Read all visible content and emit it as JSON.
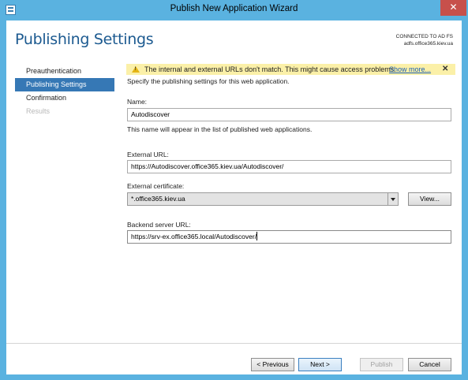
{
  "window": {
    "title": "Publish New Application Wizard",
    "close_glyph": "✕"
  },
  "header": {
    "title": "Publishing Settings",
    "connection_label": "CONNECTED TO AD FS",
    "connection_server": "adfs.office365.kiev.ua"
  },
  "nav": {
    "items": [
      {
        "label": "Preauthentication",
        "state": "normal"
      },
      {
        "label": "Publishing Settings",
        "state": "active"
      },
      {
        "label": "Confirmation",
        "state": "normal"
      },
      {
        "label": "Results",
        "state": "disabled"
      }
    ]
  },
  "warning": {
    "text": "The internal and external URLs don't match. This might cause access problems.",
    "link": "Show more...",
    "close_glyph": "✕"
  },
  "form": {
    "intro": "Specify the publishing settings for this web application.",
    "name_label": "Name:",
    "name_value": "Autodiscover",
    "name_help": "This name will appear in the list of published web applications.",
    "external_url_label": "External URL:",
    "external_url_value": "https://Autodiscover.office365.kiev.ua/Autodiscover/",
    "certificate_label": "External certificate:",
    "certificate_value": "*.office365.kiev.ua",
    "view_button": "View...",
    "backend_label": "Backend server URL:",
    "backend_value": "https://srv-ex.office365.local/Autodiscover/"
  },
  "footer": {
    "previous": "< Previous",
    "next": "Next >",
    "publish": "Publish",
    "cancel": "Cancel"
  },
  "colors": {
    "frame": "#5ab2e0",
    "heading": "#1c5a90",
    "nav_active": "#3678b5",
    "warning_bg": "#fbf0a8",
    "close_button": "#c7504b"
  }
}
